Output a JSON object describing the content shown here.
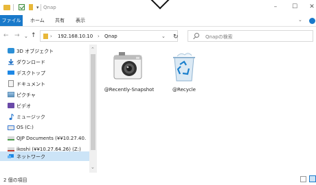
{
  "window": {
    "title": "Qnap",
    "controls": {
      "minimize": "–",
      "maximize": "☐",
      "close": "✕"
    }
  },
  "ribbon": {
    "tabs": [
      "ファイル",
      "ホーム",
      "共有",
      "表示"
    ]
  },
  "navigation": {
    "back": "←",
    "forward": "→",
    "history": "⌄",
    "up": "↑"
  },
  "address": {
    "segments": [
      "192.168.10.10",
      "Qnap"
    ],
    "separator": "›",
    "refresh": "↻"
  },
  "search": {
    "placeholder": "Qnapの検索"
  },
  "sidebar": {
    "items": [
      {
        "label": "3D オブジェクト",
        "icon": "3d-objects-icon",
        "color": "#2b8fd6"
      },
      {
        "label": "ダウンロード",
        "icon": "download-icon",
        "color": "#1e6fc4"
      },
      {
        "label": "デスクトップ",
        "icon": "desktop-icon",
        "color": "#1e88e5"
      },
      {
        "label": "ドキュメント",
        "icon": "documents-icon",
        "color": "#8a8a8a"
      },
      {
        "label": "ピクチャ",
        "icon": "pictures-icon",
        "color": "#5c8fb8"
      },
      {
        "label": "ビデオ",
        "icon": "videos-icon",
        "color": "#6a4aa8"
      },
      {
        "label": "ミュージック",
        "icon": "music-icon",
        "color": "#2a7ad0"
      },
      {
        "label": "OS (C:)",
        "icon": "drive-icon",
        "color": "#3a7bd5"
      },
      {
        "label": "QJP Documents (¥¥10.27.40.",
        "icon": "network-drive-icon",
        "color": "#4a9a4a"
      },
      {
        "label": "ikoshi (¥¥10.27.64.26) (Z:)",
        "icon": "network-drive-disconnected-icon",
        "color": "#c0392b"
      },
      {
        "label": "ネットワーク",
        "icon": "network-icon",
        "color": "#1e88e5"
      }
    ],
    "selected_index": 10
  },
  "files": [
    {
      "name": "@Recently-Snapshot",
      "icon": "camera-folder-icon"
    },
    {
      "name": "@Recycle",
      "icon": "recycle-bin-icon"
    }
  ],
  "status": {
    "item_count": "2 個の項目"
  }
}
